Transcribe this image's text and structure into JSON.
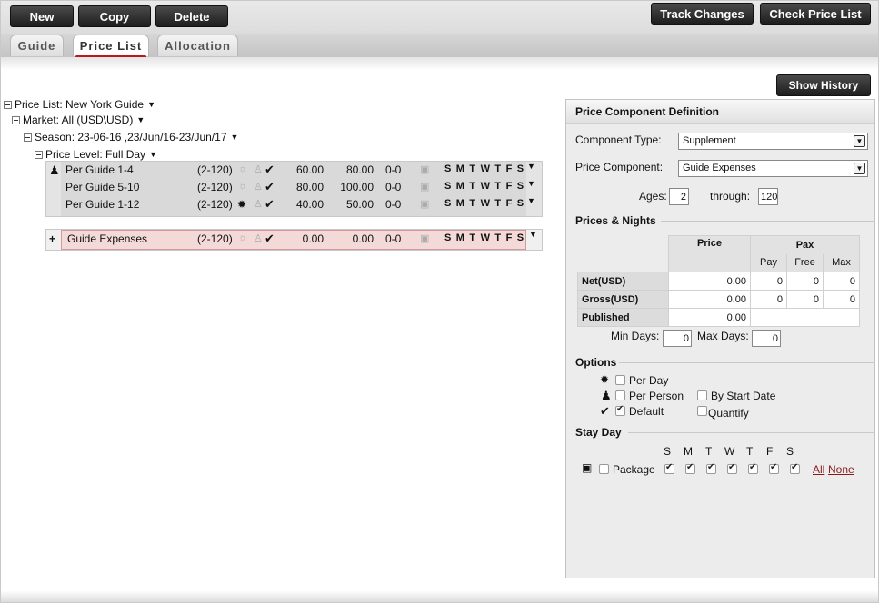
{
  "toolbar": {
    "new_label": "New",
    "copy_label": "Copy",
    "delete_label": "Delete",
    "track_changes_label": "Track Changes",
    "check_price_list_label": "Check Price List"
  },
  "tabs": [
    {
      "label": "Guide",
      "active": false
    },
    {
      "label": "Price List",
      "active": true
    },
    {
      "label": "Allocation",
      "active": false
    }
  ],
  "show_history_label": "Show History",
  "tree": {
    "price_list": "Price List: New York Guide",
    "market": "Market: All (USD\\USD)",
    "season": "Season: 23-06-16 ,23/Jun/16-23/Jun/17",
    "price_level": "Price Level: Full Day",
    "rows": [
      {
        "name": "Per Guide 1-4",
        "ages": "(2-120)",
        "price": "60.00",
        "gross": "80.00",
        "range": "0-0",
        "days": "S M T W T F S"
      },
      {
        "name": "Per Guide 5-10",
        "ages": "(2-120)",
        "price": "80.00",
        "gross": "100.00",
        "range": "0-0",
        "days": "S M T W T F S"
      },
      {
        "name": "Per Guide 1-12",
        "ages": "(2-120)",
        "price": "40.00",
        "gross": "50.00",
        "range": "0-0",
        "days": "S M T W T F S"
      }
    ],
    "expense_row": {
      "plus": "+",
      "name": "Guide Expenses",
      "ages": "(2-120)",
      "price": "0.00",
      "gross": "0.00",
      "range": "0-0",
      "days": "S M T W T F S"
    }
  },
  "panel": {
    "title": "Price Component Definition",
    "component_type_label": "Component Type:",
    "component_type_value": "Supplement",
    "price_component_label": "Price Component:",
    "price_component_value": "Guide Expenses",
    "ages_label": "Ages:",
    "ages_from": "2",
    "through_label": "through:",
    "ages_to": "120",
    "prices_nights_title": "Prices & Nights",
    "table": {
      "price_header": "Price",
      "pax_header": "Pax",
      "pay_header": "Pay",
      "free_header": "Free",
      "max_header": "Max",
      "rows": [
        {
          "label": "Net(USD)",
          "price": "0.00",
          "pay": "0",
          "free": "0",
          "max": "0"
        },
        {
          "label": "Gross(USD)",
          "price": "0.00",
          "pay": "0",
          "free": "0",
          "max": "0"
        },
        {
          "label": "Published",
          "price": "0.00"
        }
      ]
    },
    "min_days_label": "Min Days:",
    "min_days_value": "0",
    "max_days_label": "Max Days:",
    "max_days_value": "0",
    "options_title": "Options",
    "options": {
      "per_day_label": "Per Day",
      "per_person_label": "Per Person",
      "default_label": "Default",
      "by_start_date_label": "By Start Date",
      "quantify_label": "Quantify",
      "per_day": false,
      "per_person": false,
      "default": true,
      "by_start_date": false,
      "quantify": false
    },
    "stay_day_title": "Stay Day",
    "day_letters": [
      "S",
      "M",
      "T",
      "W",
      "T",
      "F",
      "S"
    ],
    "package_label": "Package",
    "all_label": "All",
    "none_label": "None"
  }
}
